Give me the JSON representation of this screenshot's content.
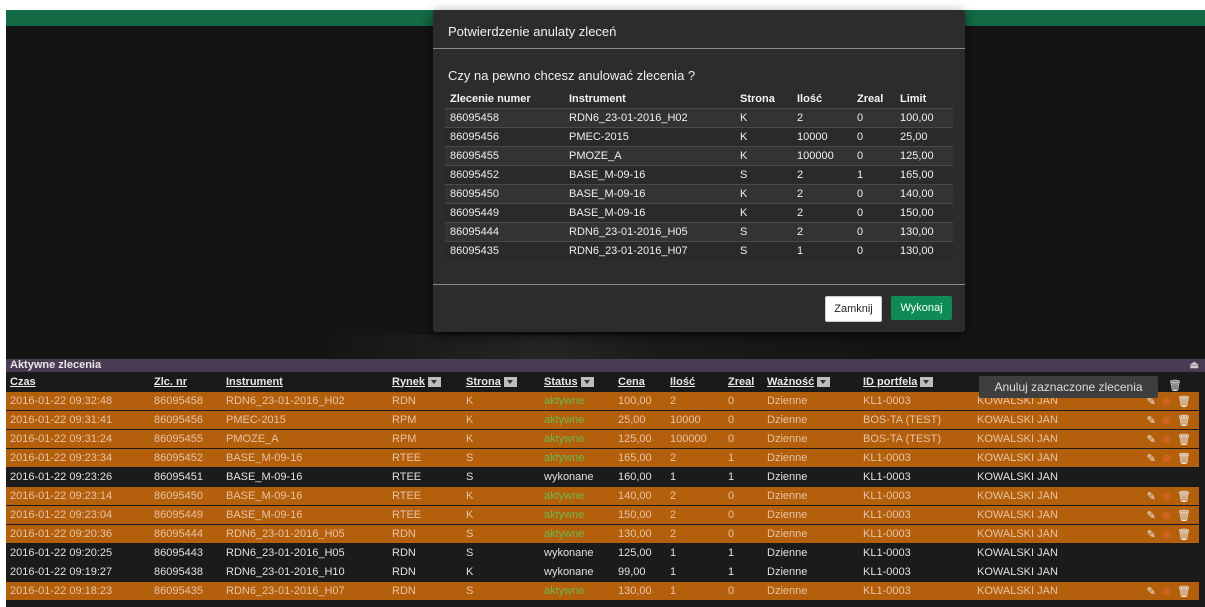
{
  "modal": {
    "title": "Potwierdzenie anulaty zleceń",
    "question": "Czy na pewno chcesz anulować zlecenia ?",
    "columns": [
      "Zlecenie numer",
      "Instrument",
      "Strona",
      "Ilość",
      "Zreal",
      "Limit"
    ],
    "rows": [
      [
        "86095458",
        "RDN6_23-01-2016_H02",
        "K",
        "2",
        "0",
        "100,00"
      ],
      [
        "86095456",
        "PMEC-2015",
        "K",
        "10000",
        "0",
        "25,00"
      ],
      [
        "86095455",
        "PMOZE_A",
        "K",
        "100000",
        "0",
        "125,00"
      ],
      [
        "86095452",
        "BASE_M-09-16",
        "S",
        "2",
        "1",
        "165,00"
      ],
      [
        "86095450",
        "BASE_M-09-16",
        "K",
        "2",
        "0",
        "140,00"
      ],
      [
        "86095449",
        "BASE_M-09-16",
        "K",
        "2",
        "0",
        "150,00"
      ],
      [
        "86095444",
        "RDN6_23-01-2016_H05",
        "S",
        "2",
        "0",
        "130,00"
      ],
      [
        "86095435",
        "RDN6_23-01-2016_H07",
        "S",
        "1",
        "0",
        "130,00"
      ]
    ],
    "close_label": "Zamknij",
    "execute_label": "Wykonaj"
  },
  "panel": {
    "title": "Aktywne zlecenia",
    "columns": [
      "Czas",
      "Zlc. nr",
      "Instrument",
      "Rynek",
      "Strona",
      "Status",
      "Cena",
      "Ilość",
      "Zreal",
      "Ważność",
      "ID portfela",
      "",
      ""
    ],
    "filter_columns": [
      3,
      4,
      5,
      9,
      10
    ],
    "tooltip": "Anuluj zaznaczone zlecenia",
    "rows": [
      {
        "state": "aktywne",
        "cells": [
          "2016-01-22 09:32:48",
          "86095458",
          "RDN6_23-01-2016_H02",
          "RDN",
          "K",
          "aktywne",
          "100,00",
          "2",
          "0",
          "Dzienne",
          "KL1-0003",
          "KOWALSKI JAN"
        ],
        "actions": true
      },
      {
        "state": "aktywne",
        "cells": [
          "2016-01-22 09:31:41",
          "86095456",
          "PMEC-2015",
          "RPM",
          "K",
          "aktywne",
          "25,00",
          "10000",
          "0",
          "Dzienne",
          "BOS-TA (TEST)",
          "KOWALSKI JAN"
        ],
        "actions": true
      },
      {
        "state": "aktywne",
        "cells": [
          "2016-01-22 09:31:24",
          "86095455",
          "PMOZE_A",
          "RPM",
          "K",
          "aktywne",
          "125,00",
          "100000",
          "0",
          "Dzienne",
          "BOS-TA (TEST)",
          "KOWALSKI JAN"
        ],
        "actions": true
      },
      {
        "state": "aktywne",
        "cells": [
          "2016-01-22 09:23:34",
          "86095452",
          "BASE_M-09-16",
          "RTEE",
          "S",
          "aktywne",
          "165,00",
          "2",
          "1",
          "Dzienne",
          "KL1-0003",
          "KOWALSKI JAN"
        ],
        "actions": true
      },
      {
        "state": "wykonane",
        "cells": [
          "2016-01-22 09:23:26",
          "86095451",
          "BASE_M-09-16",
          "RTEE",
          "S",
          "wykonane",
          "160,00",
          "1",
          "1",
          "Dzienne",
          "KL1-0003",
          "KOWALSKI JAN"
        ],
        "actions": false
      },
      {
        "state": "aktywne",
        "cells": [
          "2016-01-22 09:23:14",
          "86095450",
          "BASE_M-09-16",
          "RTEE",
          "K",
          "aktywne",
          "140,00",
          "2",
          "0",
          "Dzienne",
          "KL1-0003",
          "KOWALSKI JAN"
        ],
        "actions": true
      },
      {
        "state": "aktywne",
        "cells": [
          "2016-01-22 09:23:04",
          "86095449",
          "BASE_M-09-16",
          "RTEE",
          "K",
          "aktywne",
          "150,00",
          "2",
          "0",
          "Dzienne",
          "KL1-0003",
          "KOWALSKI JAN"
        ],
        "actions": true
      },
      {
        "state": "aktywne",
        "cells": [
          "2016-01-22 09:20:36",
          "86095444",
          "RDN6_23-01-2016_H05",
          "RDN",
          "S",
          "aktywne",
          "130,00",
          "2",
          "0",
          "Dzienne",
          "KL1-0003",
          "KOWALSKI JAN"
        ],
        "actions": true
      },
      {
        "state": "wykonane",
        "cells": [
          "2016-01-22 09:20:25",
          "86095443",
          "RDN6_23-01-2016_H05",
          "RDN",
          "S",
          "wykonane",
          "125,00",
          "1",
          "1",
          "Dzienne",
          "KL1-0003",
          "KOWALSKI JAN"
        ],
        "actions": false
      },
      {
        "state": "wykonane",
        "cells": [
          "2016-01-22 09:19:27",
          "86095438",
          "RDN6_23-01-2016_H10",
          "RDN",
          "K",
          "wykonane",
          "99,00",
          "1",
          "1",
          "Dzienne",
          "KL1-0003",
          "KOWALSKI JAN"
        ],
        "actions": false
      },
      {
        "state": "aktywne",
        "cells": [
          "2016-01-22 09:18:23",
          "86095435",
          "RDN6_23-01-2016_H07",
          "RDN",
          "S",
          "aktywne",
          "130,00",
          "1",
          "0",
          "Dzienne",
          "KL1-0003",
          "KOWALSKI JAN"
        ],
        "actions": true
      }
    ]
  },
  "colors": {
    "header_green": "#136a44",
    "panel_head": "#4a3b53",
    "active_row": "#b35f0c",
    "status_active": "#6fb84a",
    "execute_button": "#0f8b55"
  },
  "icons": [
    "pencil-icon",
    "cancel-icon",
    "trash-icon",
    "eject-icon",
    "sort-filter-icon"
  ]
}
